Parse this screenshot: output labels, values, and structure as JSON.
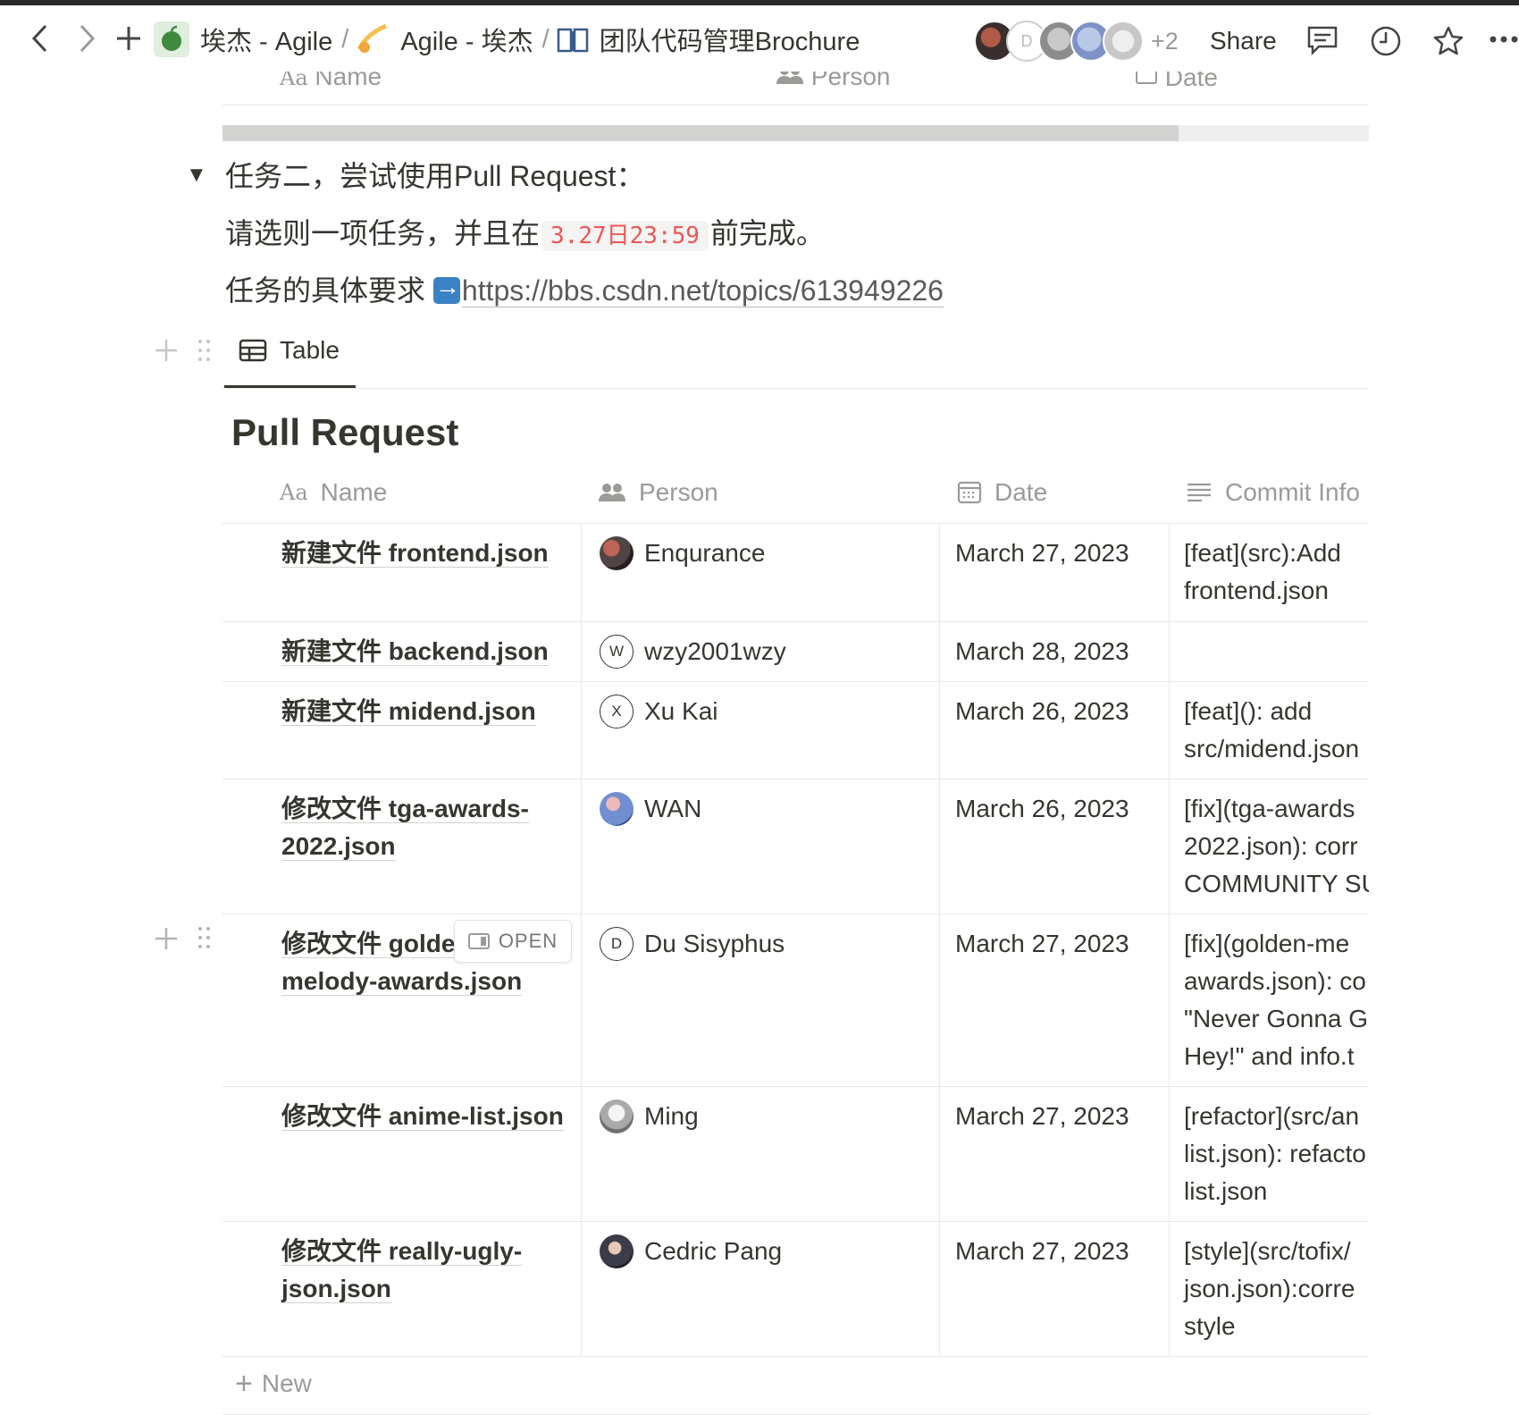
{
  "topbar": {
    "breadcrumb": [
      {
        "label": "埃杰 - Agile",
        "icon": "apple-icon"
      },
      {
        "label": "Agile - 埃杰",
        "icon": "comet-icon"
      },
      {
        "label": "团队代码管理Brochure",
        "icon": "open-book-icon"
      }
    ],
    "separator": "/",
    "avatar_letter": "D",
    "more_count": "+2",
    "share_label": "Share"
  },
  "ghost_header": {
    "name": "Name",
    "person": "Person",
    "date": "Date"
  },
  "task": {
    "title": "任务二，尝试使用Pull Request：",
    "line1_before": "请选则一项任务，并且在",
    "deadline": "3.27日23:59",
    "line1_after": "前完成。",
    "line2_before": "任务的具体要求 ",
    "link": "https://bbs.csdn.net/topics/613949226"
  },
  "view_tab": {
    "label": "Table"
  },
  "database": {
    "title": "Pull Request",
    "columns": {
      "name": "Name",
      "person": "Person",
      "date": "Date",
      "commit": "Commit Info"
    },
    "rows": [
      {
        "name": "新建文件 frontend.json",
        "person": "Enqurance",
        "avatar": "photo-dark",
        "date": "March 27, 2023",
        "commit": [
          "[feat](src):Add",
          "frontend.json"
        ]
      },
      {
        "name": "新建文件 backend.json",
        "person": "wzy2001wzy",
        "avatar": "W",
        "date": "March 28, 2023",
        "commit": []
      },
      {
        "name": "新建文件 midend.json",
        "person": "Xu Kai",
        "avatar": "X",
        "date": "March 26, 2023",
        "commit": [
          "[feat](): add",
          "src/midend.json"
        ]
      },
      {
        "name": "修改文件 tga-awards-2022.json",
        "person": "WAN",
        "avatar": "photo-blue",
        "date": "March 26, 2023",
        "commit": [
          "[fix](tga-awards",
          "2022.json): corr",
          "COMMUNITY SU"
        ]
      },
      {
        "name": "修改文件 golden-melody-awards.json",
        "person": "Du Sisyphus",
        "avatar": "D",
        "date": "March 27, 2023",
        "commit": [
          "[fix](golden-me",
          "awards.json): co",
          "\"Never Gonna G",
          "Hey!\" and info.t"
        ]
      },
      {
        "name": "修改文件 anime-list.json",
        "person": "Ming",
        "avatar": "photo-gray",
        "date": "March 27, 2023",
        "commit": [
          "[refactor](src/an",
          "list.json): refacto",
          "list.json"
        ]
      },
      {
        "name": "修改文件 really-ugly-json.json",
        "person": "Cedric Pang",
        "avatar": "photo-night",
        "date": "March 27, 2023",
        "commit": [
          "[style](src/tofix/",
          "json.json):corre",
          "style"
        ]
      }
    ],
    "open_label": "OPEN",
    "new_label": "New"
  }
}
